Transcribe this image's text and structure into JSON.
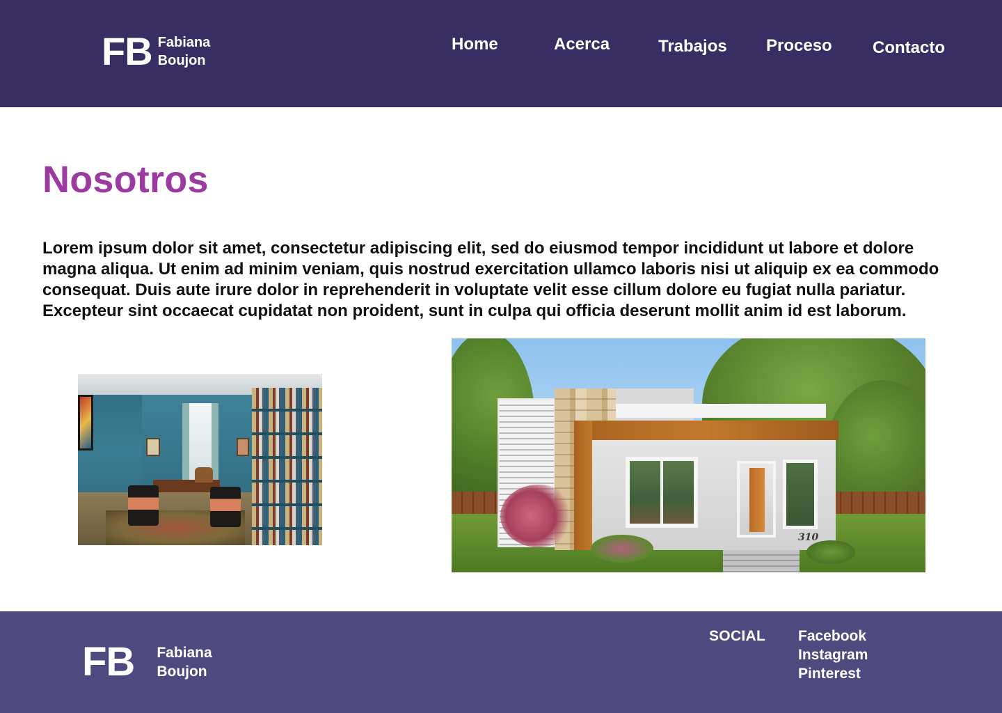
{
  "header": {
    "logo": {
      "mark": "FB",
      "name_line1": "Fabiana",
      "name_line2": "Boujon"
    },
    "nav": [
      {
        "label": "Home"
      },
      {
        "label": "Acerca"
      },
      {
        "label": "Trabajos"
      },
      {
        "label": "Proceso"
      },
      {
        "label": "Contacto"
      }
    ]
  },
  "main": {
    "title": "Nosotros",
    "paragraph": "Lorem ipsum dolor sit amet, consectetur adipiscing elit, sed do eiusmod tempor incididunt ut labore et dolore magna aliqua. Ut enim ad minim veniam, quis nostrud exercitation ullamco laboris nisi ut aliquip ex ea commodo consequat. Duis aute irure dolor in reprehenderit in voluptate velit esse cillum dolore eu fugiat nulla pariatur. Excepteur sint occaecat cupidatat non proident, sunt in culpa qui officia deserunt mollit anim id est laborum.",
    "house_number": "310"
  },
  "footer": {
    "logo": {
      "mark": "FB",
      "name_line1": "Fabiana",
      "name_line2": "Boujon"
    },
    "social_label": "SOCIAL",
    "social_links": [
      {
        "label": "Facebook"
      },
      {
        "label": "Instagram"
      },
      {
        "label": "Pinterest"
      }
    ]
  },
  "colors": {
    "header_bg": "#382e63",
    "footer_bg": "#4e4a7f",
    "title_accent": "#9b3aa0",
    "text": "#111111",
    "nav_text": "#ffffff"
  }
}
